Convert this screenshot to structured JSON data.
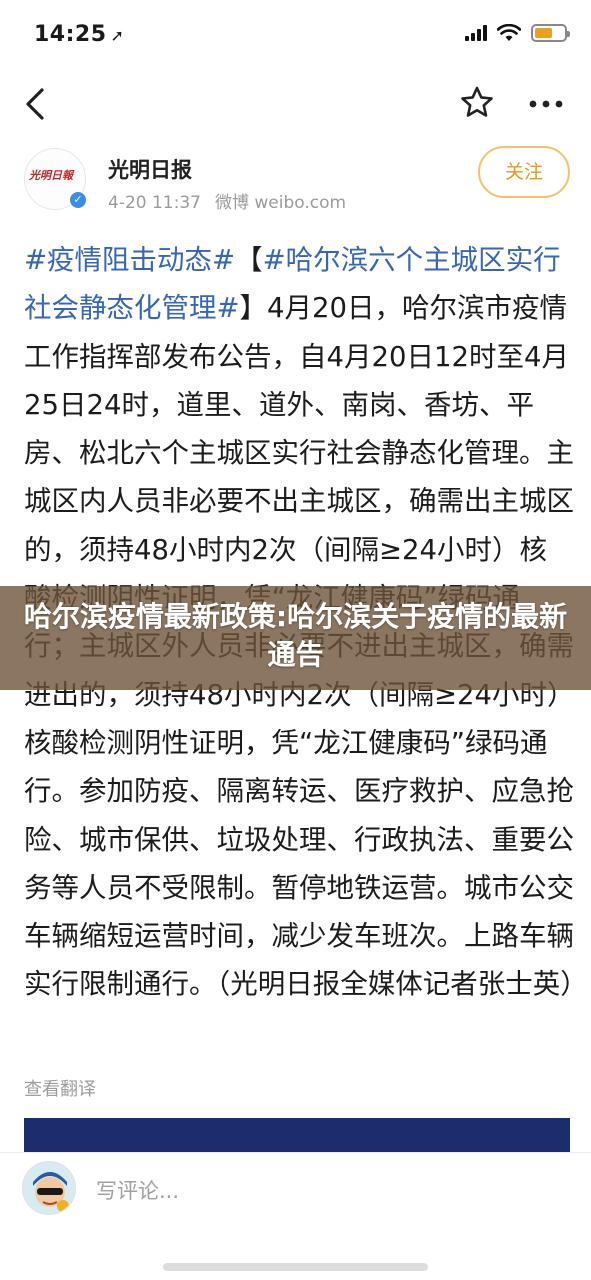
{
  "status_bar": {
    "time": "14:25",
    "battery_color": "#e8a020"
  },
  "nav": {
    "back_icon": "chevron-left-icon",
    "favorite_icon": "star-outline-icon",
    "more_icon": "more-horizontal-icon"
  },
  "author": {
    "name": "光明日报",
    "date": "4-20 11:37",
    "source": "微博 weibo.com",
    "follow_label": "关注",
    "avatar_logo_text": "光明日報"
  },
  "post": {
    "hashtag_1": "#疫情阻击动态#",
    "hashtag_2_open": "【",
    "hashtag_2": "#哈尔滨六个主城区实行社会静态化管理#",
    "hashtag_2_close": "】",
    "body": "4月20日，哈尔滨市疫情工作指挥部发布公告，自4月20日12时至4月25日24时，道里、道外、南岗、香坊、平房、松北六个主城区实行社会静态化管理。主城区内人员非必要不出主城区，确需出主城区的，须持48小时内2次（间隔≥24小时）核酸检测阴性证明，凭“龙江健康码”绿码通行；主城区外人员非必要不进出主城区，确需进出的，须持48小时内2次（间隔≥24小时）核酸检测阴性证明，凭“龙江健康码”绿码通行。参加防疫、隔离转运、医疗救护、应急抢险、城市保供、垃圾处理、行政执法、重要公务等人员不受限制。暂停地铁运营。城市公交车辆缩短运营时间，减少发车班次。上路车辆实行限制通行。（光明日报全媒体记者张士英）",
    "translate_label": "查看翻译",
    "link_color": "#3566b8"
  },
  "banner": {
    "title": "哈尔滨疫情最新政策:哈尔滨关于疫情的最新通告"
  },
  "comment_bar": {
    "placeholder": "写评论..."
  }
}
